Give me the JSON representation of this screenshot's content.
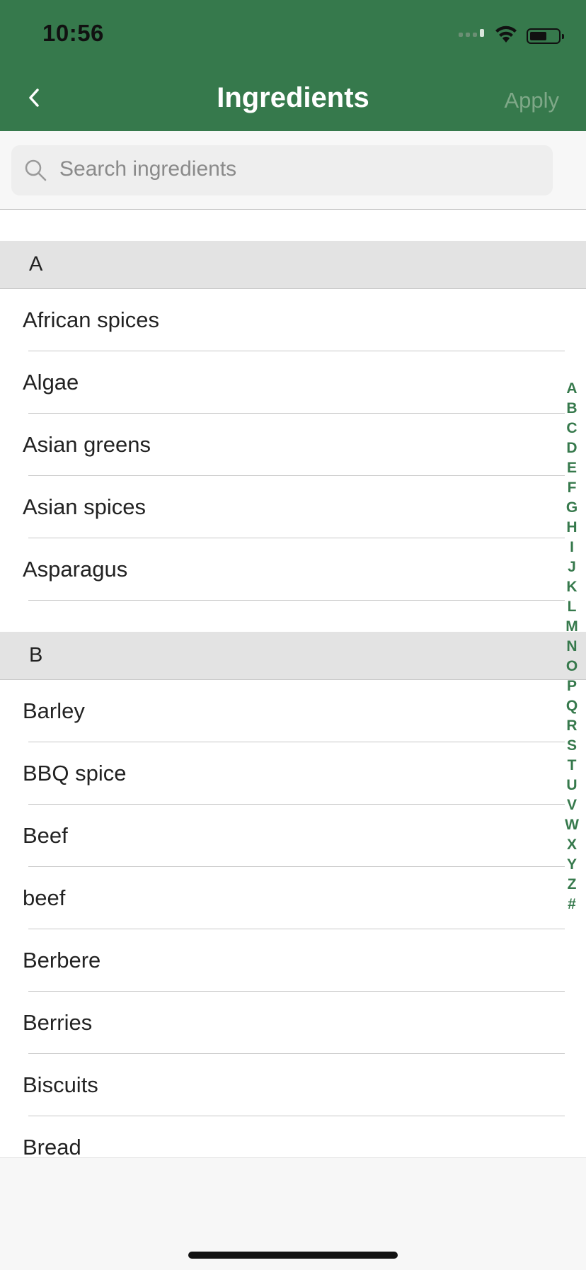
{
  "status_bar": {
    "time": "10:56"
  },
  "nav": {
    "title": "Ingredients",
    "apply_label": "Apply"
  },
  "search": {
    "placeholder": "Search ingredients"
  },
  "sections": [
    {
      "letter": "A",
      "items": [
        "African spices",
        "Algae",
        "Asian greens",
        "Asian spices",
        "Asparagus"
      ]
    },
    {
      "letter": "B",
      "items": [
        "Barley",
        "BBQ spice",
        "Beef",
        "beef",
        "Berbere",
        "Berries",
        "Biscuits",
        "Bread"
      ]
    }
  ],
  "index_letters": [
    "A",
    "B",
    "C",
    "D",
    "E",
    "F",
    "G",
    "H",
    "I",
    "J",
    "K",
    "L",
    "M",
    "N",
    "O",
    "P",
    "Q",
    "R",
    "S",
    "T",
    "U",
    "V",
    "W",
    "X",
    "Y",
    "Z",
    "#"
  ],
  "colors": {
    "brand": "#36794c",
    "apply_disabled": "#7fa888"
  }
}
